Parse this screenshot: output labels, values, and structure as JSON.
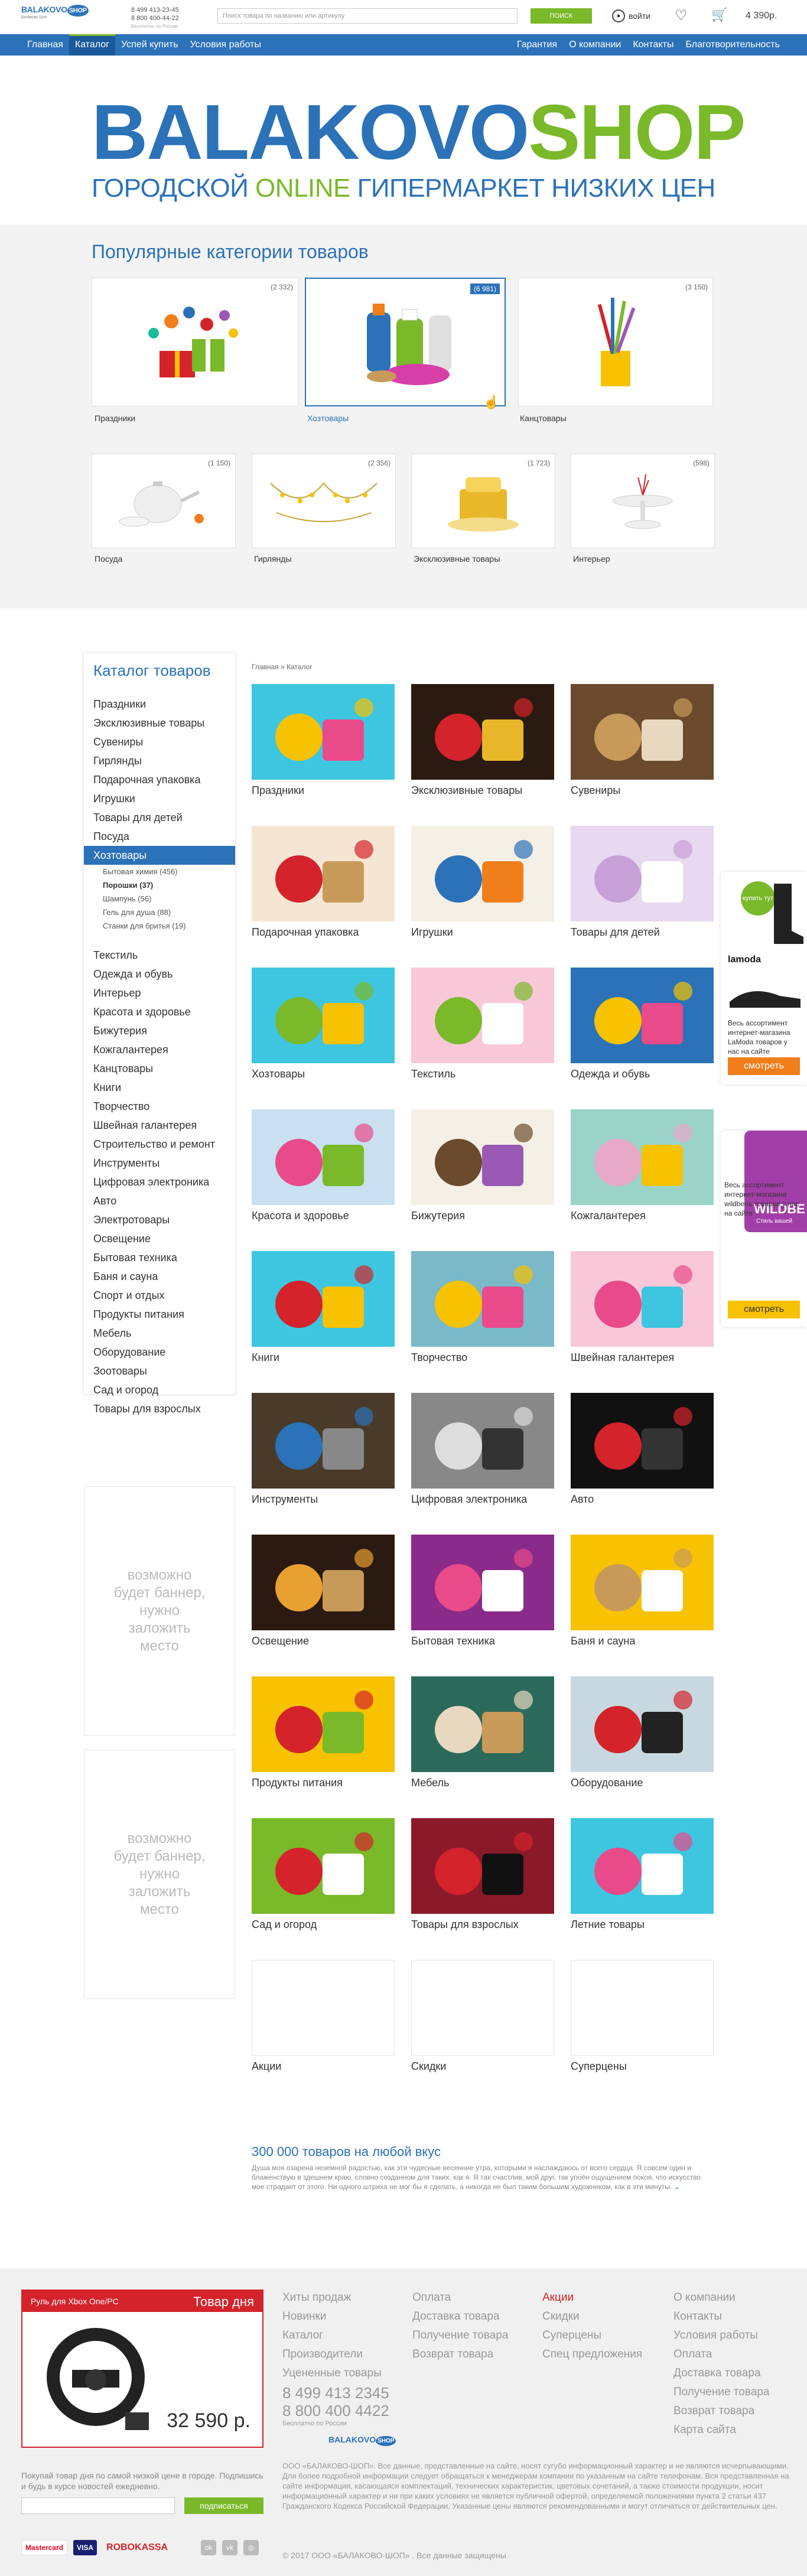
{
  "header": {
    "logo_main": "BALAKOVO",
    "logo_shop": "SHOP",
    "logo_sub": "Балаково Шоп",
    "phone1": "8 499 413-23-45",
    "phone2": "8 800 400-44-22",
    "phone_note": "Бесплатно по России",
    "search_placeholder": "Поиск товара по названию или артикулу",
    "search_button": "ПОИСК",
    "login": "войти",
    "cart_sum": "4 390р."
  },
  "nav": {
    "left": [
      "Главная",
      "Каталог",
      "Успей купить",
      "Условия работы"
    ],
    "right": [
      "Гарантия",
      "О компании",
      "Контакты",
      "Благотворительность"
    ],
    "active": "Каталог"
  },
  "hero": {
    "title_blue": "BALAKOVO",
    "title_green": "SHOP",
    "sub_part1": "ГОРОДСКОЙ ",
    "sub_green": "ONLINE",
    "sub_part2": " ГИПЕРМАРКЕТ НИЗКИХ ЦЕН"
  },
  "popular": {
    "title": "Популярные категории товаров",
    "row1": [
      {
        "label": "Праздники",
        "count": "(2 332)"
      },
      {
        "label": "Хозтовары",
        "count": "(6 981)"
      },
      {
        "label": "Канцтовары",
        "count": "(3 150)"
      }
    ],
    "row2": [
      {
        "label": "Посуда",
        "count": "(1 150)"
      },
      {
        "label": "Гирлянды",
        "count": "(2 356)"
      },
      {
        "label": "Эксклюзивные товары",
        "count": "(1 723)"
      },
      {
        "label": "Интерьер",
        "count": "(598)"
      }
    ]
  },
  "sidebar": {
    "title": "Каталог товаров",
    "items_top": [
      "Праздники",
      "Эксклюзивные товары",
      "Сувениры",
      "Гирлянды",
      "Подарочная упаковка",
      "Игрушки",
      "Товары для детей",
      "Посуда"
    ],
    "active": "Хозтовары",
    "subitems": [
      {
        "label": "Бытовая химия (456)",
        "bold": false
      },
      {
        "label": "Порошки (37)",
        "bold": true
      },
      {
        "label": "Шампунь (56)",
        "bold": false
      },
      {
        "label": "Гель для душа (88)",
        "bold": false
      },
      {
        "label": "Станки для бритья (19)",
        "bold": false
      }
    ],
    "items_bottom": [
      "Текстиль",
      "Одежда и обувь",
      "Интерьер",
      "Красота и здоровье",
      "Бижутерия",
      "Кожгалантерея",
      "Канцтовары",
      "Книги",
      "Творчество",
      "Швейная галантерея",
      "Строительство и ремонт",
      "Инструменты",
      "Цифровая электроника",
      "Авто",
      "Электротовары",
      "Освещение",
      "Бытовая техника",
      "Баня и сауна",
      "Спорт и отдых",
      "Продукты питания",
      "Мебель",
      "Оборудование",
      "Зоотовары",
      "Сад и огород",
      "Товары для взрослых"
    ]
  },
  "banners": {
    "text": "возможно будет баннер, нужно заложить место"
  },
  "breadcrumb": "Главная » Каталог",
  "categories": [
    "Праздники",
    "Эксклюзивные товары",
    "Сувениры",
    "Подарочная упаковка",
    "Игрушки",
    "Товары для детей",
    "Хозтовары",
    "Текстиль",
    "Одежда и обувь",
    "Красота и здоровье",
    "Бижутерия",
    "Кожгалантерея",
    "Книги",
    "Творчество",
    "Швейная галантерея",
    "Инструменты",
    "Цифровая электроника",
    "Авто",
    "Освещение",
    "Бытовая техника",
    "Баня и сауна",
    "Продукты питания",
    "Мебель",
    "Оборудование",
    "Сад и огород",
    "Товары для взрослых",
    "Летние товары",
    "Акции",
    "Скидки",
    "Суперцены"
  ],
  "seo": {
    "title": "300 000 товаров на любой вкус",
    "text": "Душа моя озарена неземной радостью, как эти чудесные весенние утра, которыми я наслаждаюсь от всего сердца. Я совсем один и блаженствую в здешнем краю, словно созданном для таких, как я. Я так счастлив, мой друг, так упоён ощущением покоя, что искусство мое страдает от этого. Ни одного штриха не мог бы я сделать, а никогда не был таким большим художником, как в эти минуты."
  },
  "ads": {
    "ad1_brand": "lamoda",
    "ad1_badge": "купить тут",
    "ad1_text": "Весь ассортимент интернет-магазина LaModa товаров у нас на сайте",
    "ad1_btn": "смотреть",
    "ad2_brand": "WILDBE",
    "ad2_sub": "Стиль вашей",
    "ad2_text": "Весь ассортимент интернет-магазина wildberis товаров у нас на сайте",
    "ad2_btn": "смотреть"
  },
  "footer": {
    "deal_name": "Руль для Xbox One/PC",
    "deal_title": "Товар дня",
    "deal_price": "32 590 р.",
    "deal_note": "Покупай товар дня по самой низкой цене в городе. Подпишись и будь в курсе новостей ежедневно.",
    "subscribe": "подписаться",
    "col1": [
      "Хиты продаж",
      "Новинки",
      "Каталог",
      "Производители",
      "Уцененные товары"
    ],
    "col2": [
      "Оплата",
      "Доставка товара",
      "Получение товара",
      "Возврат товара"
    ],
    "col3": [
      "Акции",
      "Скидки",
      "Суперцены",
      "Спец предложения"
    ],
    "col4": [
      "О компании",
      "Контакты",
      "Условия работы",
      "Оплата",
      "Доставка товара",
      "Получение товара",
      "Возврат товара",
      "Карта сайта"
    ],
    "phone1": "8 499 413 2345",
    "phone2": "8 800 400 4422",
    "phone_note": "Бесплатно по России",
    "legal": "ООО «БАЛАКОВО-ШОП». Все данные, представленные на сайте, носят сугубо информационный характер и не являются исчерпывающими. Для более подробной информации следует обращаться к менеджерам компании по указанным на сайте телефонам. Вся представленная на сайте информация, касающаяся комплектаций, технических характеристик, цветовых сочетаний, а также стоимости продукции, носит информационный характер и ни при каких условиях не является публичной офертой, определяемой положениями пункта 2 статьи 437 Гражданского Кодекса Российской Федерации. Указанные цены являются рекомендованными и могут отличаться от действительных цен.",
    "copyright": "© 2017 ООО «БАЛАКОВО-ШОП» . Все данные защищены",
    "pay": [
      "Mastercard",
      "VISA",
      "ROBOKASSA"
    ],
    "social": [
      "Одноклассники",
      "ВКонтакте",
      "Instagram"
    ]
  }
}
